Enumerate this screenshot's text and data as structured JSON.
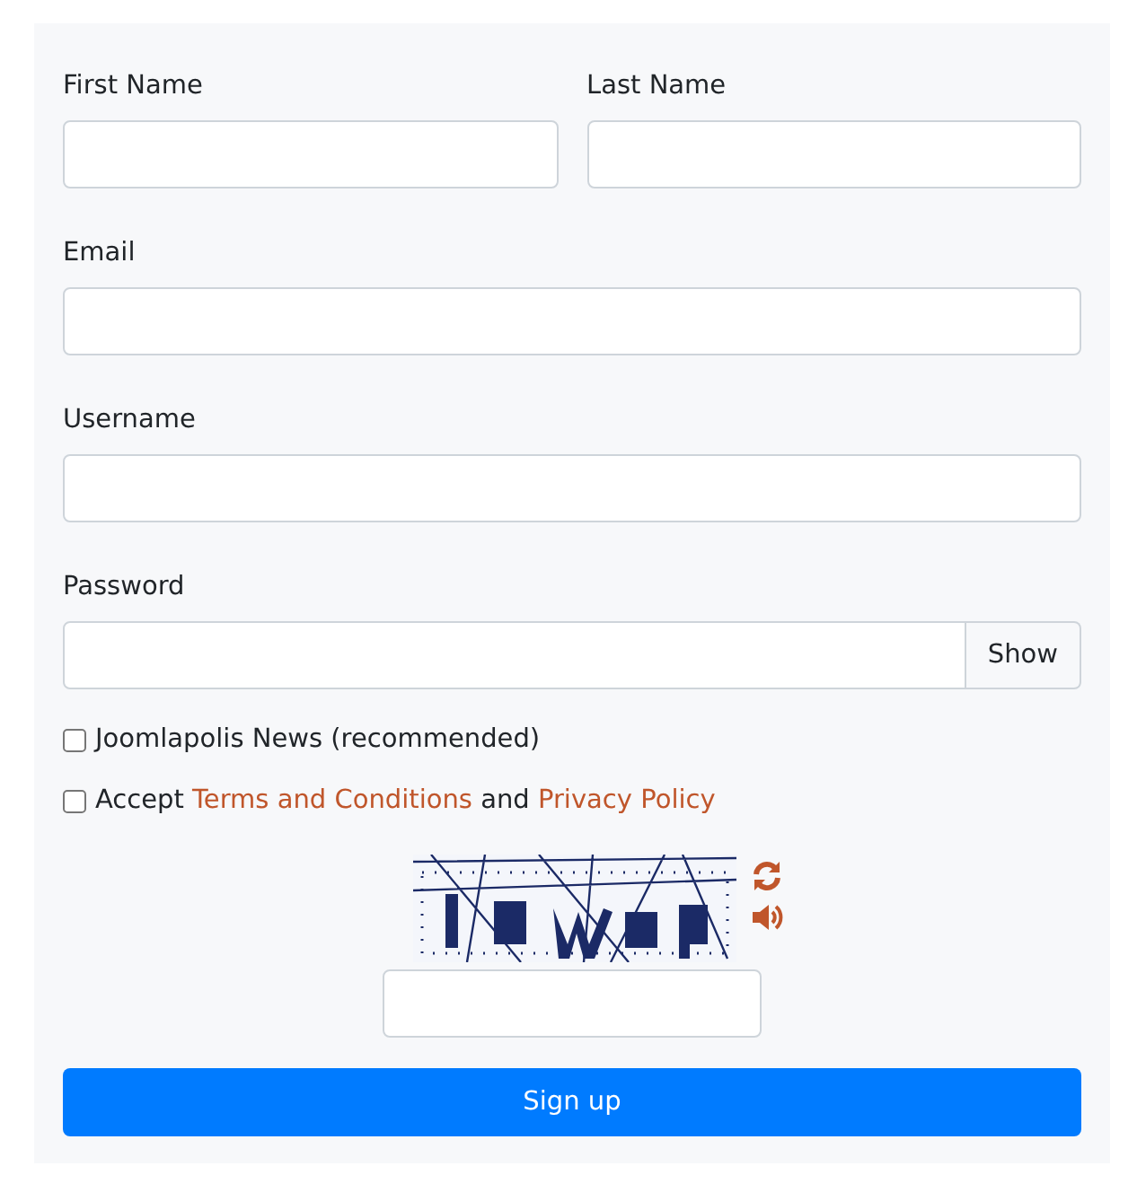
{
  "name_fields": [
    {
      "label": "First Name"
    },
    {
      "label": "Last Name"
    }
  ],
  "fields": [
    {
      "label": "Email"
    },
    {
      "label": "Username"
    }
  ],
  "password": {
    "label": "Password",
    "toggle": "Show"
  },
  "checkboxes": [
    {
      "checked": false,
      "segments": [
        {
          "kind": "text",
          "text": "Joomlapolis News (recommended)"
        }
      ]
    },
    {
      "checked": false,
      "segments": [
        {
          "kind": "text",
          "text": "Accept"
        },
        {
          "kind": "link",
          "text": "Terms and Conditions"
        },
        {
          "kind": "text",
          "text": "and"
        },
        {
          "kind": "link",
          "text": "Privacy Policy"
        }
      ]
    }
  ],
  "submit": "Sign up"
}
